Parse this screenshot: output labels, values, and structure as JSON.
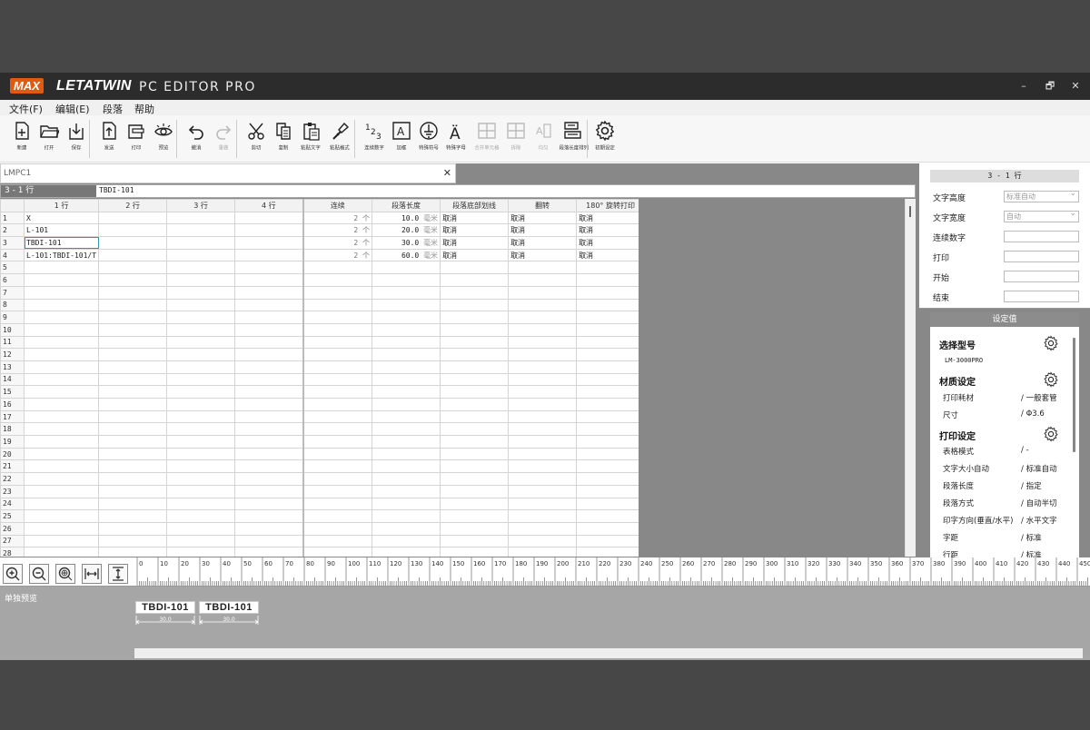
{
  "app": {
    "brand": "MAX",
    "name": "LETATWIN",
    "product": "PC EDITOR PRO"
  },
  "window_controls": {
    "minimize": "–",
    "restore": "🗗",
    "close": "✕"
  },
  "menu": [
    "文件(F)",
    "编辑(E)",
    "段落",
    "帮助"
  ],
  "toolbar": [
    {
      "label": "新建",
      "icon": "new-file-icon"
    },
    {
      "label": "打开",
      "icon": "folder-open-icon"
    },
    {
      "label": "保存",
      "icon": "save-icon"
    },
    {
      "label": "发送",
      "icon": "send-icon"
    },
    {
      "label": "打印",
      "icon": "print-icon"
    },
    {
      "label": "预览",
      "icon": "preview-eye-icon"
    },
    {
      "label": "撤消",
      "icon": "undo-icon"
    },
    {
      "label": "重做",
      "icon": "redo-icon"
    },
    {
      "label": "剪切",
      "icon": "cut-icon"
    },
    {
      "label": "复制",
      "icon": "copy-icon"
    },
    {
      "label": "粘贴文字",
      "icon": "paste-text-icon"
    },
    {
      "label": "粘贴格式",
      "icon": "paste-format-icon"
    },
    {
      "label": "连续数字",
      "icon": "sequence-number-icon"
    },
    {
      "label": "加框",
      "icon": "frame-icon"
    },
    {
      "label": "特殊符号",
      "icon": "special-symbol-icon"
    },
    {
      "label": "特殊字母",
      "icon": "special-letter-icon"
    },
    {
      "label": "合并单元格",
      "icon": "merge-cells-icon"
    },
    {
      "label": "拆除",
      "icon": "split-cells-icon"
    },
    {
      "label": "均匀",
      "icon": "even-spacing-icon"
    },
    {
      "label": "段落长度排列",
      "icon": "length-sort-icon"
    },
    {
      "label": "初期设定",
      "icon": "gear-icon"
    }
  ],
  "doc": {
    "tab_title": "LMPC1",
    "cell_ref": "3 - 1 行",
    "cell_value": "TBDI-101",
    "columns": [
      "1 行",
      "2 行",
      "3 行",
      "4 行",
      "连续",
      "段落长度",
      "段落底部划线",
      "翻转",
      "180° 旋转打印"
    ],
    "rows": [
      {
        "n": "1",
        "c1": "X",
        "count": "2 个",
        "len": "10.0",
        "unit": "毫米",
        "ul": "取消",
        "flip": "取消",
        "rot": "取消"
      },
      {
        "n": "2",
        "c1": "L-101",
        "count": "2 个",
        "len": "20.0",
        "unit": "毫米",
        "ul": "取消",
        "flip": "取消",
        "rot": "取消"
      },
      {
        "n": "3",
        "c1": "TBDI-101",
        "count": "2 个",
        "len": "30.0",
        "unit": "毫米",
        "ul": "取消",
        "flip": "取消",
        "rot": "取消"
      },
      {
        "n": "4",
        "c1": "L-101:TBDI-101/T",
        "count": "2 个",
        "len": "60.0",
        "unit": "毫米",
        "ul": "取消",
        "flip": "取消",
        "rot": "取消"
      }
    ],
    "total_rows": 28,
    "selected_row": 3
  },
  "props": {
    "header": "3 - 1 行",
    "fields": [
      {
        "label": "文字高度",
        "value": "标准自动",
        "dropdown": true
      },
      {
        "label": "文字宽度",
        "value": "自动",
        "dropdown": true
      },
      {
        "label": "连续数字",
        "value": "",
        "dropdown": false
      },
      {
        "label": "打印",
        "value": "",
        "dropdown": false
      },
      {
        "label": "开始",
        "value": "",
        "dropdown": false
      },
      {
        "label": "结束",
        "value": "",
        "dropdown": false
      }
    ]
  },
  "settings": {
    "title": "设定值",
    "model_title": "选择型号",
    "model": "LM-3000PRO",
    "material_title": "材质设定",
    "material": [
      {
        "k": "打印耗材",
        "v": "/ 一般套管"
      },
      {
        "k": "尺寸",
        "v": "/ Φ3.6"
      }
    ],
    "print_title": "打印设定",
    "print": [
      {
        "k": "表格模式",
        "v": "/ -"
      },
      {
        "k": "文字大小自动",
        "v": "/ 标准自动"
      },
      {
        "k": "段落长度",
        "v": "/ 指定"
      },
      {
        "k": "段落方式",
        "v": "/ 自动半切"
      },
      {
        "k": "印字方向(垂直/水平)",
        "v": "/ 水平文字"
      },
      {
        "k": "字距",
        "v": "/ 标准"
      },
      {
        "k": "行距",
        "v": "/ 标准"
      }
    ]
  },
  "preview": {
    "label": "单独预览",
    "labels": [
      {
        "text": "TBDI-101",
        "dim": "30.0"
      },
      {
        "text": "TBDI-101",
        "dim": "30.0"
      }
    ],
    "ruler_ticks": [
      "0",
      "10",
      "20",
      "30",
      "40",
      "50",
      "60",
      "70",
      "80",
      "90",
      "100",
      "110",
      "120",
      "130",
      "140",
      "150",
      "160",
      "170",
      "180",
      "190",
      "200",
      "210",
      "220",
      "230",
      "240",
      "250",
      "260",
      "270",
      "280",
      "290",
      "300",
      "310",
      "320",
      "330",
      "340",
      "350",
      "360",
      "370",
      "380",
      "390",
      "400",
      "410",
      "420",
      "430",
      "440",
      "450"
    ]
  },
  "colors": {
    "brand_orange": "#e05b12",
    "titlebar": "#2c2c2c",
    "selection": "#3a8fb7"
  }
}
